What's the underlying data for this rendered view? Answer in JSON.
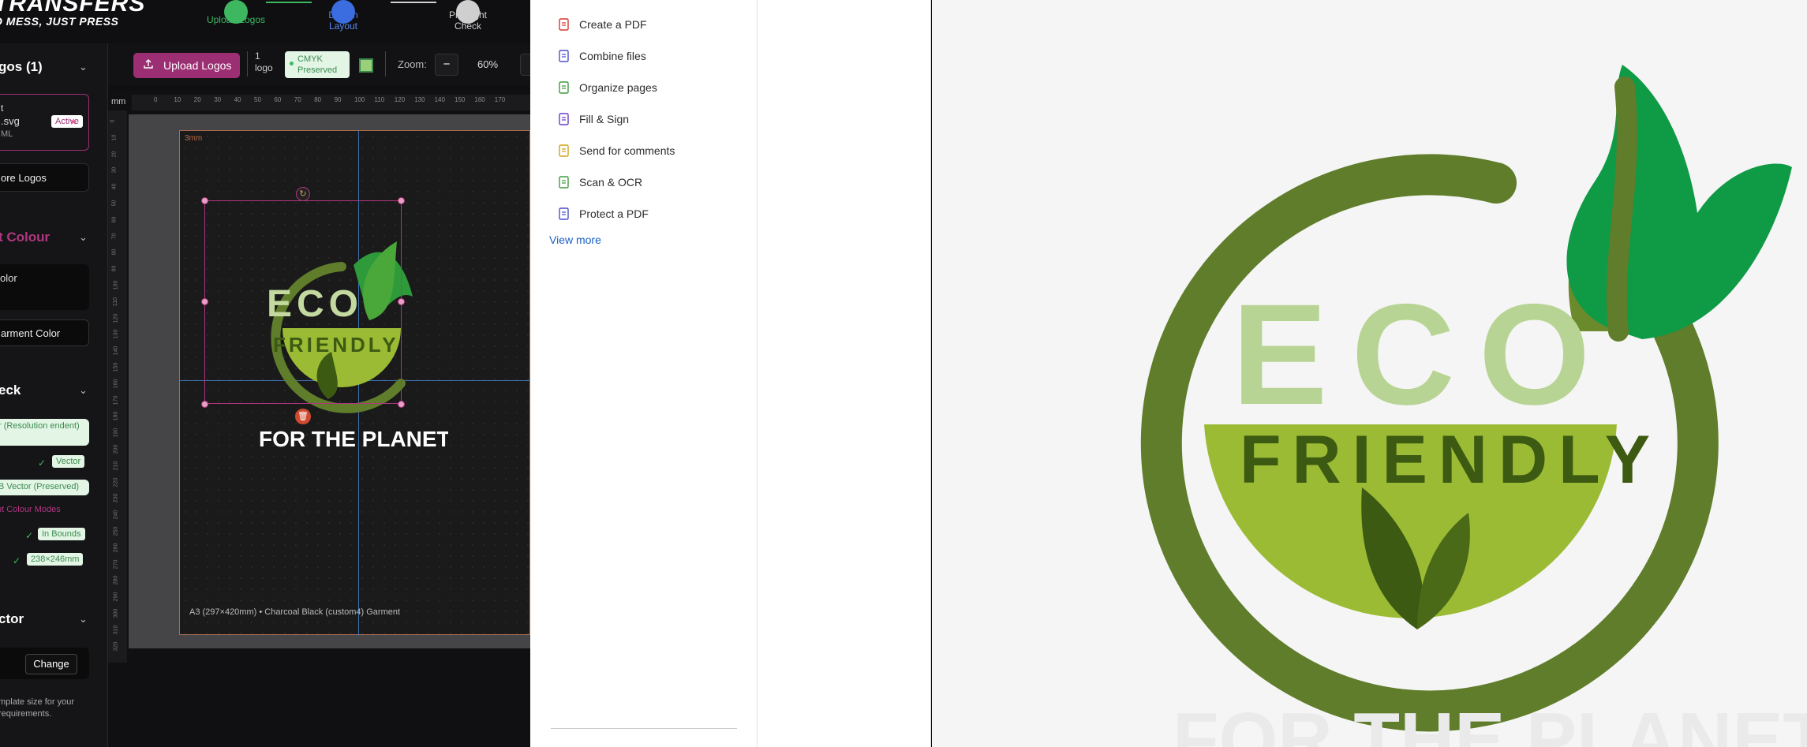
{
  "brand": {
    "line1": "TRANSFERS",
    "line2": "O MESS, JUST PRESS"
  },
  "steps": [
    {
      "label": "Upload Logos",
      "color": "#3db861"
    },
    {
      "label": "Design Layout",
      "color": "#3b6de0"
    },
    {
      "label": "Pre-flight Check",
      "color": "#cfcfcf"
    }
  ],
  "sidebar": {
    "logos_heading": "gos (1)",
    "file_name_a": "t",
    "file_name_b": ".svg",
    "file_type": "ML",
    "active_badge": "Active",
    "remove": "×",
    "more_logos": "ore Logos",
    "colour_heading": "t Colour",
    "color_option": "olor",
    "garment_color": "arment Color",
    "check_heading": "eck",
    "resolution": "r (Resolution endent)",
    "vector_badge": "Vector",
    "vector_preserved": "B Vector (Preserved)",
    "colour_modes": "ut Colour Modes",
    "in_bounds": "In Bounds",
    "dimensions": "238×246mm",
    "vector_heading": "ctor",
    "change": "Change",
    "template_note": "mplate size for your requirements."
  },
  "toolbar": {
    "upload": "Upload Logos",
    "logo_count": "1 logo",
    "cmyk": "CMYK Preserved",
    "zoom_label": "Zoom:",
    "zoom_minus": "−",
    "zoom_value": "60%",
    "ruler_unit": "mm"
  },
  "canvas": {
    "bleed": "3mm",
    "footer": "A3 (297×420mm) • Charcoal Black (custom4) Garment",
    "h_ticks": [
      "0",
      "10",
      "20",
      "30",
      "40",
      "50",
      "60",
      "70",
      "80",
      "90",
      "100",
      "110",
      "120",
      "130",
      "140",
      "150",
      "160",
      "170"
    ],
    "v_ticks": [
      "0",
      "10",
      "20",
      "30",
      "40",
      "50",
      "60",
      "70",
      "80",
      "90",
      "100",
      "110",
      "120",
      "130",
      "140",
      "150",
      "160",
      "170",
      "180",
      "190",
      "200",
      "210",
      "220",
      "230",
      "240",
      "250",
      "260",
      "270",
      "280",
      "290",
      "300",
      "310",
      "320"
    ]
  },
  "logo": {
    "eco": "ECO",
    "friendly": "FRIENDLY",
    "planet": "FOR THE PLANET"
  },
  "menu": {
    "items": [
      {
        "label": "Create a PDF",
        "icon": "create-pdf-icon",
        "color": "#d8362f"
      },
      {
        "label": "Combine files",
        "icon": "combine-files-icon",
        "color": "#4a4fcc"
      },
      {
        "label": "Organize pages",
        "icon": "organize-pages-icon",
        "color": "#3f9a3f"
      },
      {
        "label": "Fill & Sign",
        "icon": "fill-sign-icon",
        "color": "#6a3dc8"
      },
      {
        "label": "Send for comments",
        "icon": "send-comments-icon",
        "color": "#d4a017"
      },
      {
        "label": "Scan & OCR",
        "icon": "scan-ocr-icon",
        "color": "#3f9a3f"
      },
      {
        "label": "Protect a PDF",
        "icon": "protect-pdf-icon",
        "color": "#4a4fcc"
      }
    ],
    "view_more": "View more"
  },
  "colors": {
    "dark_green": "#5f7d2b",
    "light_green": "#b8d494",
    "mid_green": "#9bbb35",
    "leaf_green": "#0f9a45",
    "deep_leaf": "#3c5a12",
    "accent": "#9c2f73"
  }
}
